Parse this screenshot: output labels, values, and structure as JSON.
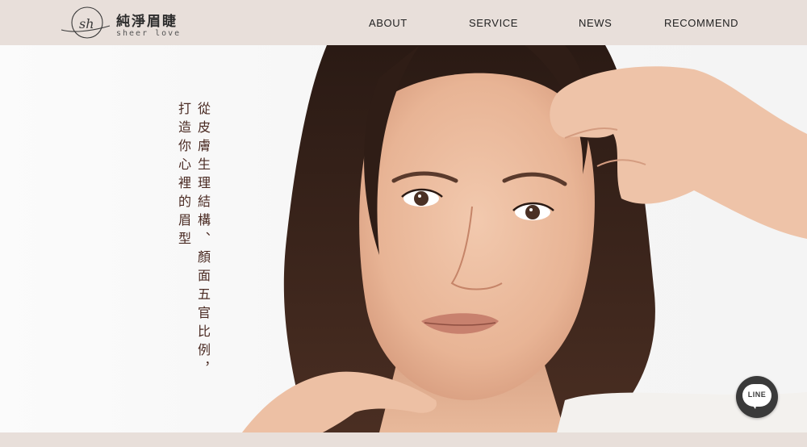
{
  "header": {
    "logo": {
      "monogram": "sh",
      "title": "純淨眉睫",
      "subtitle": "sheer love"
    },
    "nav": [
      {
        "label": "ABOUT"
      },
      {
        "label": "SERVICE"
      },
      {
        "label": "NEWS"
      },
      {
        "label": "RECOMMEND"
      }
    ]
  },
  "hero": {
    "tagline_col1": "從皮膚生理結構、顏面五官比例，",
    "tagline_col2": "打造你心裡的眉型",
    "photo": "portrait-of-woman-touching-forehead"
  },
  "floating": {
    "line_button": {
      "label": "LINE",
      "icon": "line-chat-icon"
    }
  },
  "colors": {
    "header_bg": "#e8dfda",
    "tagline": "#4a2a22",
    "line_button": "#3a3a3a"
  }
}
